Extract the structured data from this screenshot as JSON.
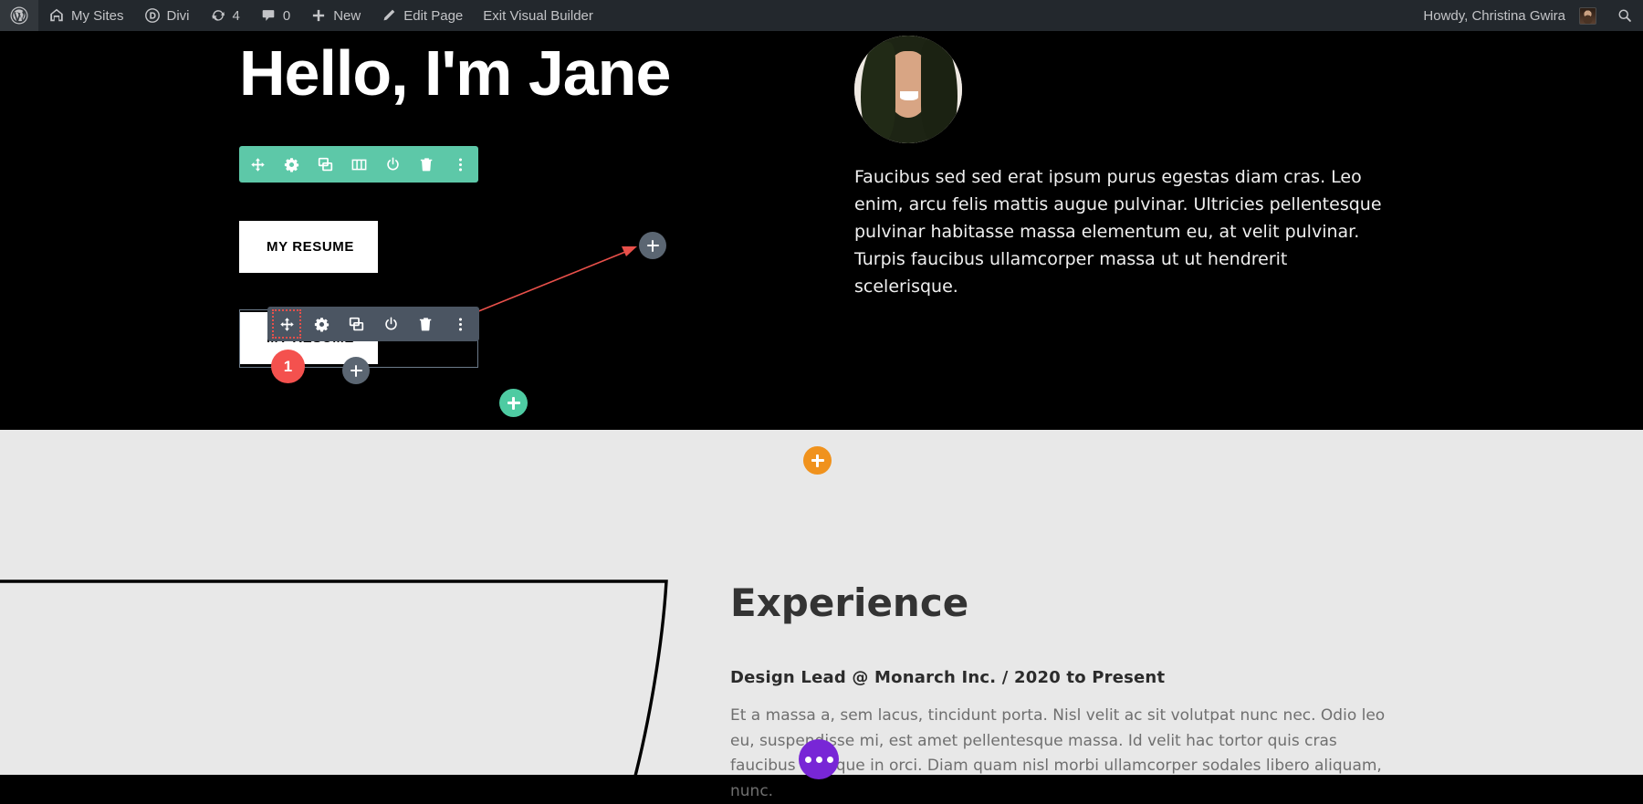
{
  "admin_bar": {
    "left_items": [
      {
        "id": "wp-logo",
        "label": "",
        "icon": "wordpress-icon"
      },
      {
        "id": "my-sites",
        "label": "My Sites",
        "icon": "sites-icon"
      },
      {
        "id": "divi",
        "label": "Divi",
        "icon": "divi-icon"
      },
      {
        "id": "updates",
        "label": "4",
        "icon": "updates-icon"
      },
      {
        "id": "comments",
        "label": "0",
        "icon": "comment-icon"
      },
      {
        "id": "new",
        "label": "New",
        "icon": "plus-icon"
      },
      {
        "id": "edit-page",
        "label": "Edit Page",
        "icon": "pencil-icon"
      },
      {
        "id": "exit-builder",
        "label": "Exit Visual Builder",
        "icon": ""
      }
    ],
    "howdy": "Howdy, Christina Gwira",
    "search_icon": "search-icon"
  },
  "hero": {
    "title": "Hello, I'm Jane",
    "resume_button_1": "MY RESUME",
    "resume_button_2": "MY RESUME",
    "paragraph": "Faucibus sed sed erat ipsum purus egestas diam cras. Leo enim, arcu felis mattis augue pulvinar. Ultricies pellentesque pulvinar habitasse massa elementum eu, at velit pulvinar. Turpis faucibus ullamcorper massa ut ut hendrerit scelerisque.",
    "background_color": "#000000"
  },
  "section_toolbar": {
    "color": "#5dc8a8",
    "buttons": [
      {
        "name": "move-handle",
        "icon": "move-icon"
      },
      {
        "name": "settings",
        "icon": "gear-icon"
      },
      {
        "name": "duplicate",
        "icon": "duplicate-icon"
      },
      {
        "name": "column-structure",
        "icon": "columns-icon"
      },
      {
        "name": "disable",
        "icon": "power-icon"
      },
      {
        "name": "delete",
        "icon": "trash-icon"
      },
      {
        "name": "more-options",
        "icon": "kebab-icon"
      }
    ]
  },
  "module_toolbar": {
    "color": "#4b5562",
    "highlight_color": "#e8504a",
    "buttons": [
      {
        "name": "move-handle",
        "icon": "move-icon",
        "highlighted": true
      },
      {
        "name": "settings",
        "icon": "gear-icon",
        "highlighted": false
      },
      {
        "name": "duplicate",
        "icon": "duplicate-icon",
        "highlighted": false
      },
      {
        "name": "disable",
        "icon": "power-icon",
        "highlighted": false
      },
      {
        "name": "delete",
        "icon": "trash-icon",
        "highlighted": false
      },
      {
        "name": "more-options",
        "icon": "kebab-icon",
        "highlighted": false
      }
    ]
  },
  "annotation": {
    "step_number": "1",
    "badge_color": "#f4514e",
    "arrow_color": "#e8504a"
  },
  "floating_buttons": {
    "grey_top": {
      "label": "+",
      "color": "#5b6672"
    },
    "grey_bot": {
      "label": "+",
      "color": "#5b6672"
    },
    "teal": {
      "label": "+",
      "color": "#4ecba2"
    },
    "orange": {
      "label": "+",
      "color": "#f0921d"
    },
    "purple": {
      "label": "",
      "color": "#7826d6",
      "icon": "ellipsis-icon"
    }
  },
  "experience": {
    "heading": "Experience",
    "job_line": "Design Lead  @  Monarch Inc.  /  2020 to Present",
    "body": "Et a massa a, sem lacus, tincidunt porta. Nisl velit ac sit volutpat nunc nec. Odio leo eu, suspendisse mi, est amet pellentesque massa. Id velit hac tortor quis cras faucibus tristique in orci. Diam quam nisl morbi ullamcorper sodales libero aliquam, nunc.",
    "background_color": "#e8e8e8"
  }
}
